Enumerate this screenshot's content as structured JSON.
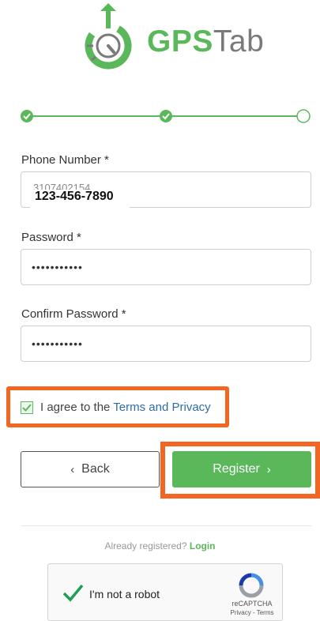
{
  "brand": {
    "gps": "GPS",
    "tab": "Tab",
    "color": "#5bb85a"
  },
  "stepper": {
    "steps": 3,
    "completed": 2
  },
  "form": {
    "phone": {
      "label": "Phone Number *",
      "value": "3107402154",
      "display": "123-456-7890"
    },
    "password": {
      "label": "Password *",
      "value": "•••••••••••"
    },
    "confirm": {
      "label": "Confirm Password *",
      "value": "•••••••••••"
    }
  },
  "agree": {
    "prefix": "I agree to the ",
    "link": "Terms and Privacy",
    "checked": true
  },
  "buttons": {
    "back": "Back",
    "register": "Register"
  },
  "login": {
    "prompt": "Already registered? ",
    "link": "Login"
  },
  "captcha": {
    "label": "I'm not a robot",
    "brand": "reCAPTCHA",
    "links": "Privacy - Terms"
  },
  "colors": {
    "accent": "#5bb85a",
    "highlight": "#f26522",
    "link": "#2d6da3"
  }
}
